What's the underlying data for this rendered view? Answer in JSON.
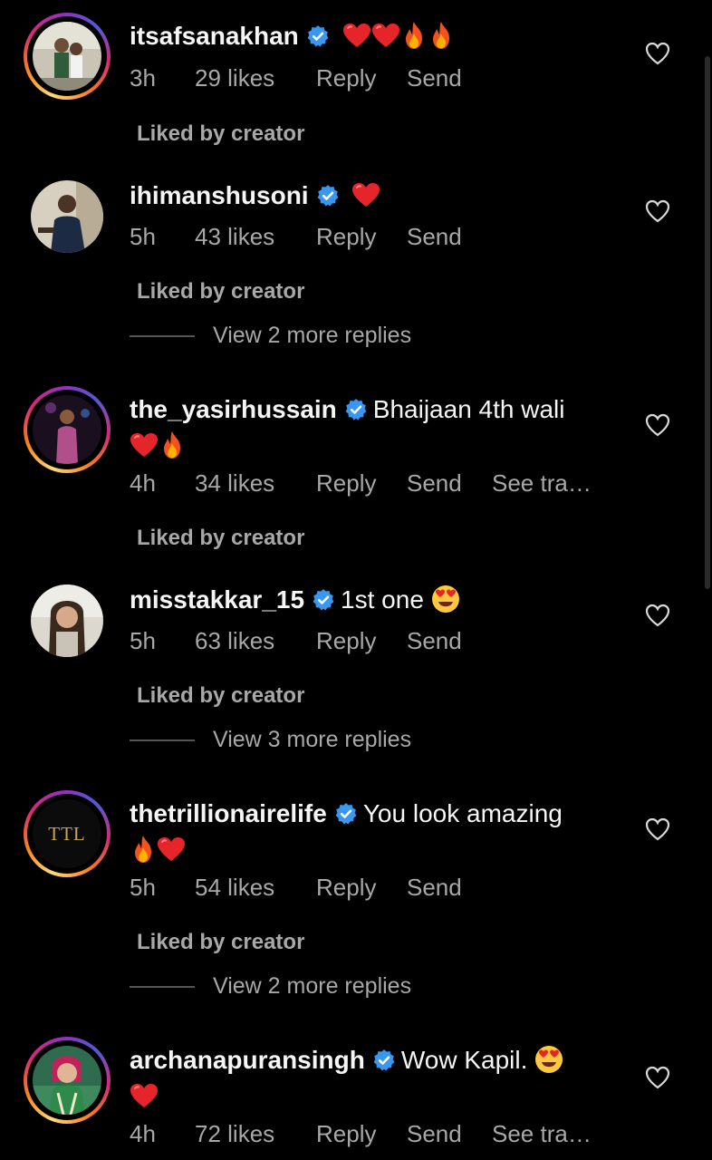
{
  "comments": [
    {
      "username": "itsafsanakhan",
      "text": "",
      "emojis_before_newline": [
        "heart",
        "heart",
        "fire",
        "fire"
      ],
      "emojis_line2": [],
      "time": "3h",
      "likes": "29 likes",
      "reply": "Reply",
      "send": "Send",
      "see_translation": "",
      "liked_by_creator": "Liked by creator",
      "view_more": "",
      "ring": true,
      "avatar_icon": "avatar-photo"
    },
    {
      "username": "ihimanshusoni",
      "text": "",
      "emojis_before_newline": [
        "heart"
      ],
      "emojis_line2": [],
      "time": "5h",
      "likes": "43 likes",
      "reply": "Reply",
      "send": "Send",
      "see_translation": "",
      "liked_by_creator": "Liked by creator",
      "view_more": "View 2 more replies",
      "ring": false,
      "avatar_icon": "avatar-photo"
    },
    {
      "username": "the_yasirhussain",
      "text": "Bhaijaan 4th wali",
      "emojis_before_newline": [],
      "emojis_line2": [
        "heart",
        "fire"
      ],
      "time": "4h",
      "likes": "34 likes",
      "reply": "Reply",
      "send": "Send",
      "see_translation": "See tra…",
      "liked_by_creator": "Liked by creator",
      "view_more": "",
      "ring": true,
      "avatar_icon": "avatar-photo"
    },
    {
      "username": "misstakkar_15",
      "text": "1st one",
      "emojis_before_newline": [
        "heart-eyes"
      ],
      "emojis_line2": [],
      "time": "5h",
      "likes": "63 likes",
      "reply": "Reply",
      "send": "Send",
      "see_translation": "",
      "liked_by_creator": "Liked by creator",
      "view_more": "View 3 more replies",
      "ring": false,
      "avatar_icon": "avatar-photo"
    },
    {
      "username": "thetrillionairelife",
      "text": "You look amazing",
      "emojis_before_newline": [],
      "emojis_line2": [
        "fire",
        "heart"
      ],
      "time": "5h",
      "likes": "54 likes",
      "reply": "Reply",
      "send": "Send",
      "see_translation": "",
      "liked_by_creator": "Liked by creator",
      "view_more": "View 2 more replies",
      "ring": true,
      "avatar_text": "TTL"
    },
    {
      "username": "archanapuransingh",
      "text": "Wow Kapil.",
      "emojis_before_newline": [
        "heart-eyes"
      ],
      "emojis_line2": [
        "heart"
      ],
      "time": "4h",
      "likes": "72 likes",
      "reply": "Reply",
      "send": "Send",
      "see_translation": "See tra…",
      "liked_by_creator": "",
      "view_more": "",
      "ring": true,
      "avatar_icon": "avatar-photo"
    }
  ],
  "colors": {
    "background": "#000000",
    "text": "#f5f5f5",
    "muted": "#a8a8a8",
    "verified": "#3897f0"
  }
}
